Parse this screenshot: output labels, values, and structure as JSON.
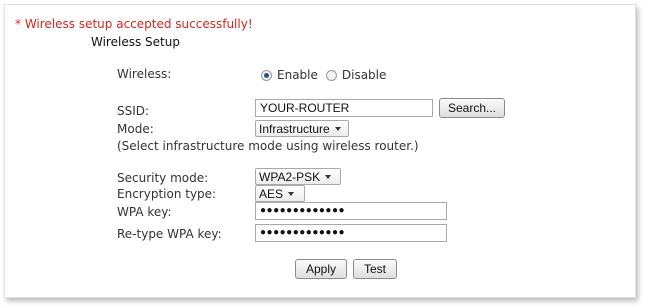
{
  "status": {
    "success_message": "* Wireless setup accepted successfully!"
  },
  "section_title": "Wireless Setup",
  "wireless": {
    "label": "Wireless:",
    "options": [
      {
        "label": "Enable",
        "checked": true
      },
      {
        "label": "Disable",
        "checked": false
      }
    ]
  },
  "ssid": {
    "label": "SSID:",
    "value": "YOUR-ROUTER",
    "search_button": "Search..."
  },
  "mode": {
    "label": "Mode:",
    "value": "Infrastructure",
    "hint": "(Select infrastructure mode using wireless router.)"
  },
  "security": {
    "label": "Security mode:",
    "value": "WPA2-PSK"
  },
  "encryption": {
    "label": "Encryption type:",
    "value": "AES"
  },
  "wpa_key": {
    "label": "WPA key:",
    "value": "●●●●●●●●●●●●●"
  },
  "retype_key": {
    "label": "Re-type WPA key:",
    "value": "●●●●●●●●●●●●●"
  },
  "buttons": {
    "apply": "Apply",
    "test": "Test"
  },
  "colors": {
    "success_text": "#d9261c",
    "radio_selected": "#2b4f8a"
  }
}
